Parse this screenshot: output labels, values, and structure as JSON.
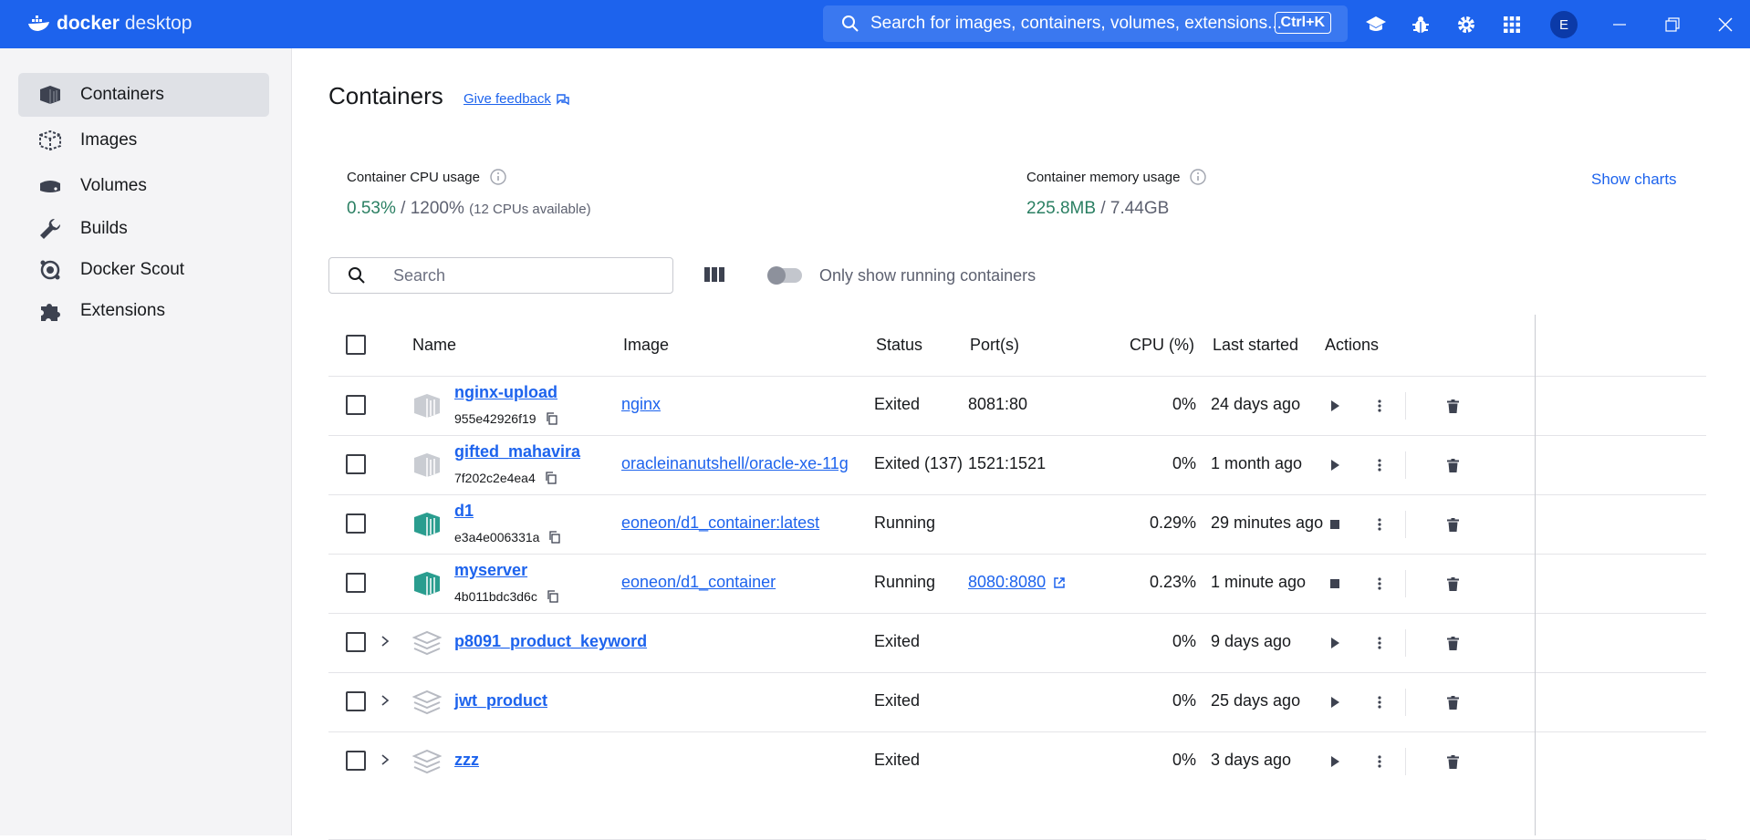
{
  "app": {
    "brand_bold": "docker",
    "brand_rest": "desktop"
  },
  "topbar": {
    "search_text": "Search for images, containers, volumes, extensions...",
    "search_shortcut": "Ctrl+K",
    "avatar_letter": "E",
    "icons": [
      "learn-icon",
      "bug-icon",
      "gear-icon",
      "grid-icon",
      "minimize-icon",
      "restore-icon",
      "close-icon"
    ]
  },
  "sidebar": {
    "items": [
      {
        "label": "Containers",
        "icon": "containers-icon",
        "active": true
      },
      {
        "label": "Images",
        "icon": "images-icon"
      },
      {
        "label": "Volumes",
        "icon": "volumes-icon"
      },
      {
        "label": "Builds",
        "icon": "wrench-icon"
      },
      {
        "label": "Docker Scout",
        "icon": "scout-icon"
      },
      {
        "label": "Extensions",
        "icon": "puzzle-icon"
      }
    ]
  },
  "main": {
    "title": "Containers",
    "feedback": "Give feedback",
    "cpu": {
      "label": "Container CPU usage",
      "used": "0.53%",
      "sep": " / ",
      "total": "1200%",
      "note": "(12 CPUs available)"
    },
    "memory": {
      "label": "Container memory usage",
      "used": "225.8MB",
      "sep": " / ",
      "total": "7.44GB"
    },
    "show_charts": "Show charts",
    "search_placeholder": "Search",
    "toggle_label": "Only show running containers"
  },
  "table": {
    "headers": {
      "name": "Name",
      "image": "Image",
      "status": "Status",
      "ports": "Port(s)",
      "cpu": "CPU (%)",
      "last_started": "Last started",
      "actions": "Actions"
    },
    "rows": [
      {
        "name": "nginx-upload",
        "id": "955e42926f19",
        "image": "nginx",
        "status": "Exited",
        "ports": "8081:80",
        "cpu": "0%",
        "last_started": "24 days ago"
      },
      {
        "name": "gifted_mahavira",
        "id": "7f202c2e4ea4",
        "image": "oracleinanutshell/oracle-xe-11g",
        "status": "Exited (137)",
        "ports": "1521:1521",
        "cpu": "0%",
        "last_started": "1 month ago"
      },
      {
        "name": "d1",
        "id": "e3a4e006331a",
        "image": "eoneon/d1_container:latest",
        "status": "Running",
        "ports": "",
        "cpu": "0.29%",
        "last_started": "29 minutes ago"
      },
      {
        "name": "myserver",
        "id": "4b011bdc3d6c",
        "image": "eoneon/d1_container",
        "status": "Running",
        "ports": "8080:8080",
        "cpu": "0.23%",
        "last_started": "1 minute ago"
      },
      {
        "name": "p8091_product_keyword",
        "id": "",
        "image": "",
        "status": "Exited",
        "ports": "",
        "cpu": "0%",
        "last_started": "9 days ago"
      },
      {
        "name": "jwt_product",
        "id": "",
        "image": "",
        "status": "Exited",
        "ports": "",
        "cpu": "0%",
        "last_started": "25 days ago"
      },
      {
        "name": "zzz",
        "id": "",
        "image": "",
        "status": "Exited",
        "ports": "",
        "cpu": "0%",
        "last_started": "3 days ago"
      }
    ]
  },
  "colors": {
    "brand": "#1d63ed",
    "running": "#2a9d8f",
    "exited": "#c9ccd2"
  }
}
